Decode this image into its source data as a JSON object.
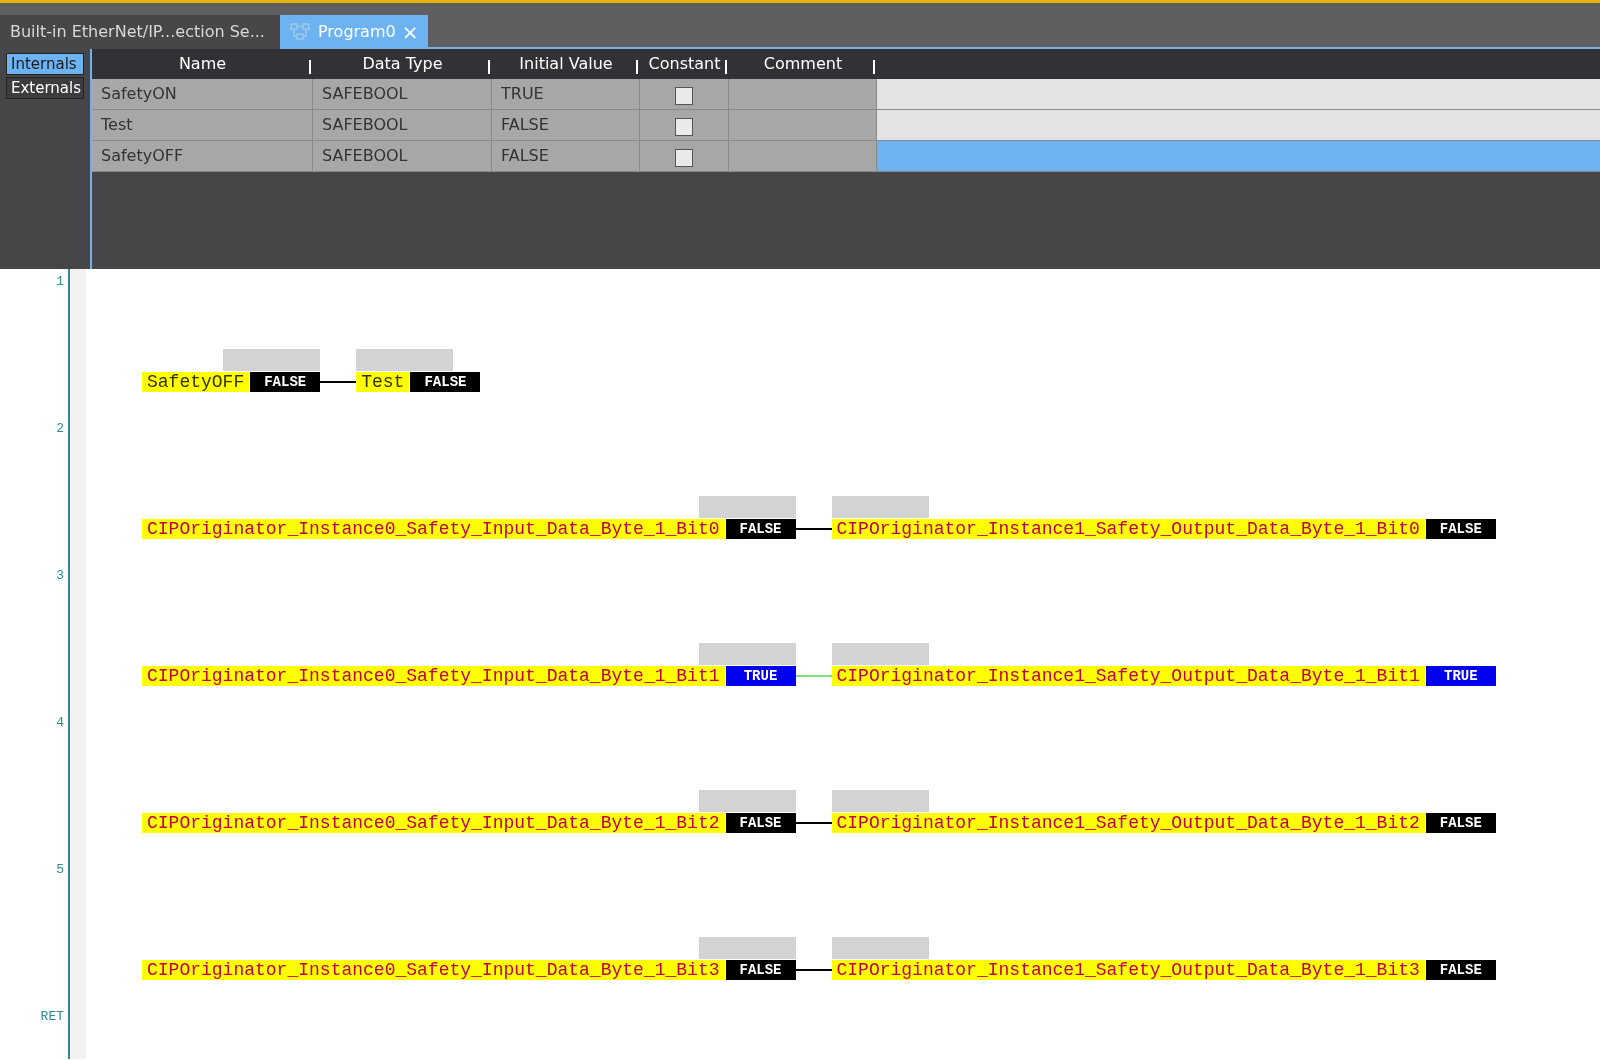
{
  "tabs": [
    {
      "label": "Built-in EtherNet/IP...ection Se...",
      "selected": false,
      "icon": false
    },
    {
      "label": "Program0",
      "selected": true,
      "icon": true,
      "close": "×"
    }
  ],
  "variable_tabs": [
    {
      "label": "Internals",
      "selected": true
    },
    {
      "label": "Externals",
      "selected": false
    }
  ],
  "table": {
    "columns": [
      "Name",
      "Data Type",
      "Initial Value",
      "Constant",
      "Comment"
    ],
    "rows": [
      {
        "name": "SafetyON",
        "data_type": "SAFEBOOL",
        "initial_value": "TRUE",
        "constant": false,
        "selected": false
      },
      {
        "name": "Test",
        "data_type": "SAFEBOOL",
        "initial_value": "FALSE",
        "constant": false,
        "selected": false
      },
      {
        "name": "SafetyOFF",
        "data_type": "SAFEBOOL",
        "initial_value": "FALSE",
        "constant": false,
        "selected": true
      }
    ]
  },
  "ladder": {
    "rungs": [
      {
        "number": "1",
        "energized": false,
        "contacts": [
          {
            "name": "SafetyOFF",
            "kind": "internal",
            "value": "FALSE",
            "on": false
          },
          {
            "name": "Test",
            "kind": "internal",
            "value": "FALSE",
            "on": false
          }
        ]
      },
      {
        "number": "2",
        "energized": false,
        "contacts": [
          {
            "name": "CIPOriginator_Instance0_Safety_Input_Data_Byte_1_Bit0",
            "kind": "external",
            "value": "FALSE",
            "on": false
          },
          {
            "name": "CIPOriginator_Instance1_Safety_Output_Data_Byte_1_Bit0",
            "kind": "external",
            "value": "FALSE",
            "on": false
          }
        ]
      },
      {
        "number": "3",
        "energized": true,
        "contacts": [
          {
            "name": "CIPOriginator_Instance0_Safety_Input_Data_Byte_1_Bit1",
            "kind": "external",
            "value": "TRUE",
            "on": true
          },
          {
            "name": "CIPOriginator_Instance1_Safety_Output_Data_Byte_1_Bit1",
            "kind": "external",
            "value": "TRUE",
            "on": true
          }
        ]
      },
      {
        "number": "4",
        "energized": false,
        "contacts": [
          {
            "name": "CIPOriginator_Instance0_Safety_Input_Data_Byte_1_Bit2",
            "kind": "external",
            "value": "FALSE",
            "on": false
          },
          {
            "name": "CIPOriginator_Instance1_Safety_Output_Data_Byte_1_Bit2",
            "kind": "external",
            "value": "FALSE",
            "on": false
          }
        ]
      },
      {
        "number": "5",
        "energized": false,
        "contacts": [
          {
            "name": "CIPOriginator_Instance0_Safety_Input_Data_Byte_1_Bit3",
            "kind": "external",
            "value": "FALSE",
            "on": false
          },
          {
            "name": "CIPOriginator_Instance1_Safety_Output_Data_Byte_1_Bit3",
            "kind": "external",
            "value": "FALSE",
            "on": false
          }
        ]
      }
    ],
    "end_label": "RET"
  }
}
